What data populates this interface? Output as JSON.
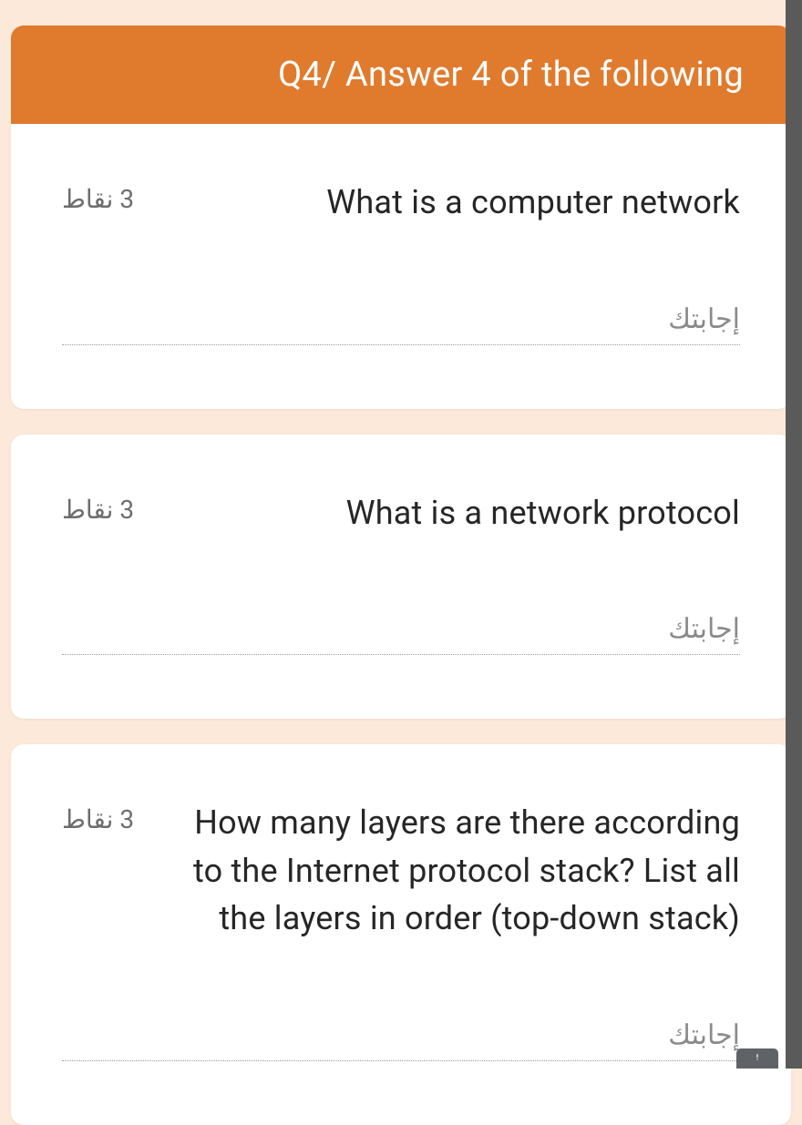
{
  "header": {
    "title": "Q4/ Answer 4 of the following"
  },
  "questions": [
    {
      "points": "3 نقاط",
      "text": "What is a computer network",
      "placeholder": "إجابتك"
    },
    {
      "points": "3 نقاط",
      "text": "What is a network protocol",
      "placeholder": "إجابتك"
    },
    {
      "points": "3 نقاط",
      "text": "How many layers are there according to the Internet protocol stack? List all the layers in order (top-down stack)",
      "placeholder": "إجابتك"
    }
  ]
}
